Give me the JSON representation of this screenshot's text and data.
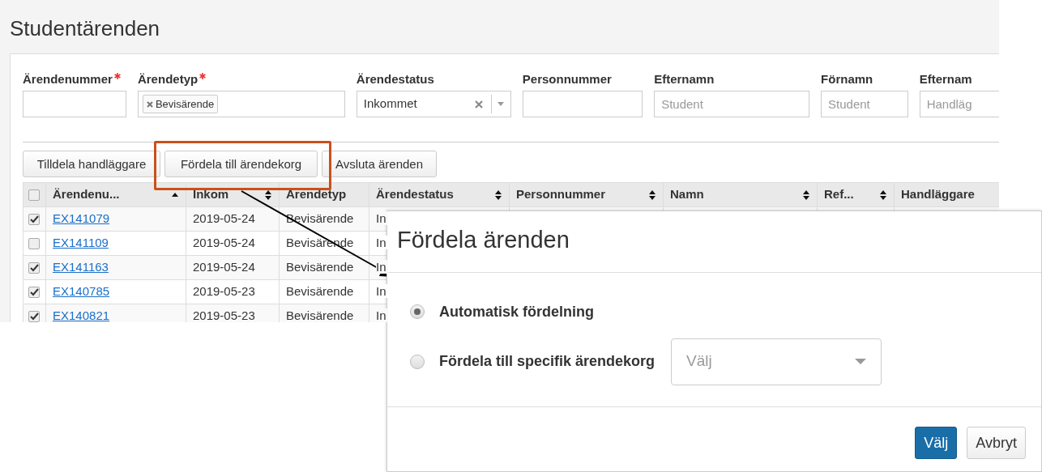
{
  "page": {
    "title": "Studentärenden"
  },
  "filters": [
    {
      "label": "Ärendenummer",
      "required": true,
      "kind": "text"
    },
    {
      "label": "Ärendetyp",
      "required": true,
      "kind": "tags",
      "tags": [
        "Bevisärende"
      ]
    },
    {
      "label": "Ärendestatus",
      "required": false,
      "kind": "select",
      "value": "Inkommet"
    },
    {
      "label": "Personnummer",
      "required": false,
      "kind": "text"
    },
    {
      "label": "Efternamn",
      "required": false,
      "kind": "text",
      "placeholder": "Student"
    },
    {
      "label": "Förnamn",
      "required": false,
      "kind": "text",
      "placeholder": "Student"
    },
    {
      "label": "Efternam",
      "required": false,
      "kind": "text",
      "placeholder": "Handläg"
    }
  ],
  "toolbar_buttons": [
    {
      "label": "Tilldela handläggare",
      "highlighted": false
    },
    {
      "label": "Fördela till ärendekorg",
      "highlighted": true
    },
    {
      "label": "Avsluta ärenden",
      "highlighted": false
    }
  ],
  "table": {
    "select_all": {
      "checked": false
    },
    "columns": [
      {
        "label": "Ärendenu...",
        "sortable": true,
        "sorted": true
      },
      {
        "label": "Inkom",
        "sortable": true,
        "sorted": false
      },
      {
        "label": "Ärendetyp",
        "sortable": false
      },
      {
        "label": "Ärendestatus",
        "sortable": true,
        "sorted": false
      },
      {
        "label": "Personnummer",
        "sortable": true,
        "sorted": false
      },
      {
        "label": "Namn",
        "sortable": true,
        "sorted": false
      },
      {
        "label": "Ref...",
        "sortable": true,
        "sorted": false
      },
      {
        "label": "Handläggare",
        "sortable": false
      }
    ],
    "rows": [
      {
        "checked": true,
        "case_number": "EX141079",
        "received": "2019-05-24",
        "type": "Bevisärende",
        "status": "In"
      },
      {
        "checked": false,
        "case_number": "EX141109",
        "received": "2019-05-24",
        "type": "Bevisärende",
        "status": "In"
      },
      {
        "checked": true,
        "case_number": "EX141163",
        "received": "2019-05-24",
        "type": "Bevisärende",
        "status": "In"
      },
      {
        "checked": true,
        "case_number": "EX140785",
        "received": "2019-05-23",
        "type": "Bevisärende",
        "status": "In"
      },
      {
        "checked": true,
        "case_number": "EX140821",
        "received": "2019-05-23",
        "type": "Bevisärende",
        "status": "In"
      }
    ]
  },
  "dialog": {
    "title": "Fördela ärenden",
    "options": [
      {
        "label": "Automatisk fördelning",
        "selected": true
      },
      {
        "label": "Fördela till specifik ärendekorg",
        "selected": false
      }
    ],
    "select": {
      "placeholder": "Välj"
    },
    "buttons": [
      {
        "label": "Välj",
        "kind": "primary"
      },
      {
        "label": "Avbryt",
        "kind": "secondary"
      }
    ]
  }
}
